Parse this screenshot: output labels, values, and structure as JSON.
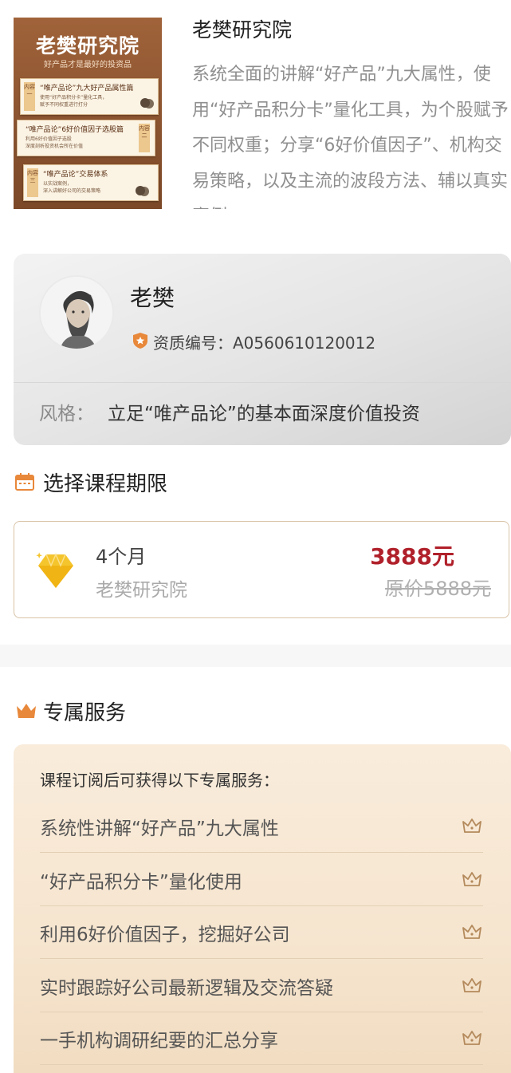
{
  "course": {
    "title": "老樊研究院",
    "description": "系统全面的讲解“好产品”九大属性，使用“好产品积分卡”量化工具，为个股赋予不同权重；分享“6好价值因子”、机构交易策略，以及主流的波段方法、辅以真实案例、",
    "cover": {
      "title": "老樊研究院",
      "subtitle": "好产品才是最好的投资品",
      "panels": [
        {
          "tag": "内容一",
          "line1": "“唯产品论”九大好产品属性篇",
          "line2": "使用“好产品积分卡”量化工具，",
          "line3": "赋予不同权重进行打分"
        },
        {
          "tag": "内容二",
          "line1": "“唯产品论”6好价值因子选股篇",
          "line2": "利用6好价值因子选股",
          "line3": "深度剖析投资机会所在价值"
        },
        {
          "tag": "内容三",
          "line1": "“唯产品论”交易体系",
          "line2": "以实战案例，",
          "line3": "深入讲解好公司的交易策略"
        }
      ]
    }
  },
  "teacher": {
    "name": "老樊",
    "qualification": "资质编号：A0560610120012",
    "style_label": "风格：",
    "style_text": "立足“唯产品论”的基本面深度价值投资"
  },
  "period": {
    "section_title": "选择课程期限",
    "option": {
      "duration": "4个月",
      "org": "老樊研究院",
      "price": "3888元",
      "original_price": "原价5888元"
    }
  },
  "services": {
    "section_title": "专属服务",
    "intro": "课程订阅后可获得以下专属服务：",
    "items": [
      "系统性讲解“好产品”九大属性",
      "“好产品积分卡”量化使用",
      "利用6好价值因子，挖掘好公司",
      "实时跟踪好公司最新逻辑及交流答疑",
      "一手机构调研纪要的汇总分享"
    ]
  },
  "colors": {
    "price_red": "#b0202a",
    "accent_orange": "#e8883a",
    "card_border": "#d8c3a5",
    "service_bg": "#f7e8d4"
  },
  "icons": {
    "calendar": "calendar-icon",
    "crown": "crown-icon",
    "diamond": "diamond-icon",
    "badge": "shield-badge-icon"
  }
}
